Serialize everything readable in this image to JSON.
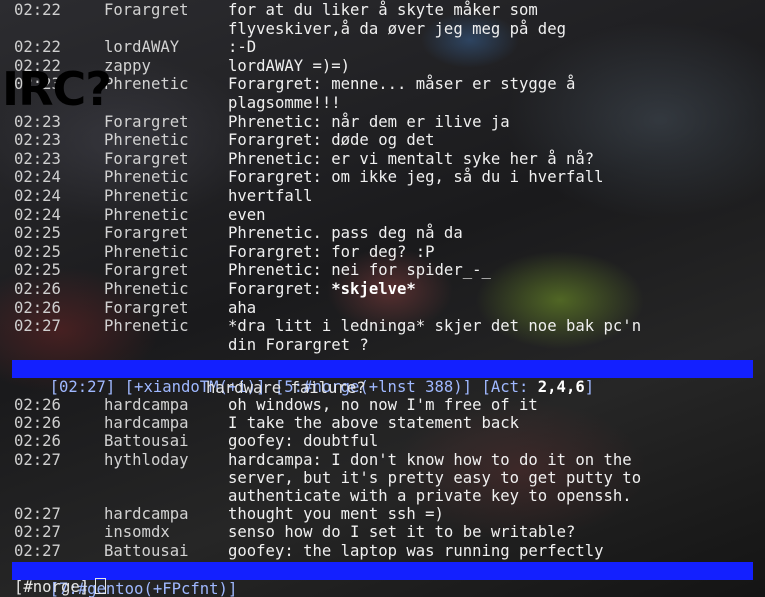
{
  "top_window": {
    "lines": [
      {
        "ts": "02:22",
        "nick": "Forargret",
        "msg": "for at du liker å skyte måker som"
      },
      {
        "ts": "",
        "nick": "",
        "msg": "flyveskiver,å da øver jeg meg på deg"
      },
      {
        "ts": "02:22",
        "nick": "lordAWAY",
        "msg": ":-D"
      },
      {
        "ts": "02:22",
        "nick": "zappy",
        "msg": "lordAWAY =)=)"
      },
      {
        "ts": "02:23",
        "nick": "Phrenetic",
        "msg": "Forargret: menne... måser er stygge å"
      },
      {
        "ts": "",
        "nick": "",
        "msg": "plagsomme!!!"
      },
      {
        "ts": "02:23",
        "nick": "Forargret",
        "msg": "Phrenetic: når dem er ilive ja"
      },
      {
        "ts": "02:23",
        "nick": "Phrenetic",
        "msg": "Forargret: døde og det"
      },
      {
        "ts": "02:23",
        "nick": "Forargret",
        "msg": "Phrenetic: er vi mentalt syke her å nå?"
      },
      {
        "ts": "02:24",
        "nick": "Phrenetic",
        "msg": "Forargret: om ikke jeg, så du i hverfall"
      },
      {
        "ts": "02:24",
        "nick": "Phrenetic",
        "msg": "hvertfall"
      },
      {
        "ts": "02:24",
        "nick": "Phrenetic",
        "msg": "even"
      },
      {
        "ts": "02:25",
        "nick": "Forargret",
        "msg": "Phrenetic. pass deg nå da"
      },
      {
        "ts": "02:25",
        "nick": "Phrenetic",
        "msg": "Forargret: for deg? :P"
      },
      {
        "ts": "02:25",
        "nick": "Forargret",
        "msg": "Phrenetic: nei for spider_-_"
      },
      {
        "ts": "02:26",
        "nick": "Phrenetic",
        "msg": "Forargret: ",
        "bold": "*skjelve*"
      },
      {
        "ts": "02:26",
        "nick": "Forargret",
        "msg": "aha"
      },
      {
        "ts": "02:27",
        "nick": "Phrenetic",
        "msg": "*dra litt i ledninga* skjer det noe bak pc'n"
      },
      {
        "ts": "",
        "nick": "",
        "msg": "din Forargret ?"
      }
    ]
  },
  "status_top": {
    "time": "[02:27]",
    "user": "[+xiandoTM(+i)]",
    "channel": "[5:#norge(+lnst 388)]",
    "act_prefix": "[Act: ",
    "act_values": "2,4,6",
    "act_suffix": "]"
  },
  "bottom_window": {
    "topic": "hardware failure?",
    "lines": [
      {
        "ts": "02:26",
        "nick": "hardcampa",
        "msg": "oh windows, no now I'm free of it"
      },
      {
        "ts": "02:26",
        "nick": "hardcampa",
        "msg": "I take the above statement back"
      },
      {
        "ts": "02:26",
        "nick": "Battousai",
        "msg": "goofey: doubtful"
      },
      {
        "ts": "02:27",
        "nick": "hythloday",
        "msg": "hardcampa: I don't know how to do it on the"
      },
      {
        "ts": "",
        "nick": "",
        "msg": "server, but it's pretty easy to get putty to"
      },
      {
        "ts": "",
        "nick": "",
        "msg": "authenticate with a private key to openssh."
      },
      {
        "ts": "02:27",
        "nick": "hardcampa",
        "msg": "thought you ment ssh =)"
      },
      {
        "ts": "02:27",
        "nick": "insomdx",
        "msg": "senso how do I set it to be writable?"
      },
      {
        "ts": "02:27",
        "nick": "Battousai",
        "msg": "goofey: the laptop was running perfectly"
      }
    ]
  },
  "status_bottom": {
    "text": "[7:#gentoo(+FPcfnt)]"
  },
  "input": {
    "prompt": "[#norge]"
  },
  "overlay_label": "IRC?",
  "colors": {
    "statusbar_bg": "#1320ff",
    "statusbar_text": "#9fb8ff",
    "highlight": "#ff5555"
  }
}
